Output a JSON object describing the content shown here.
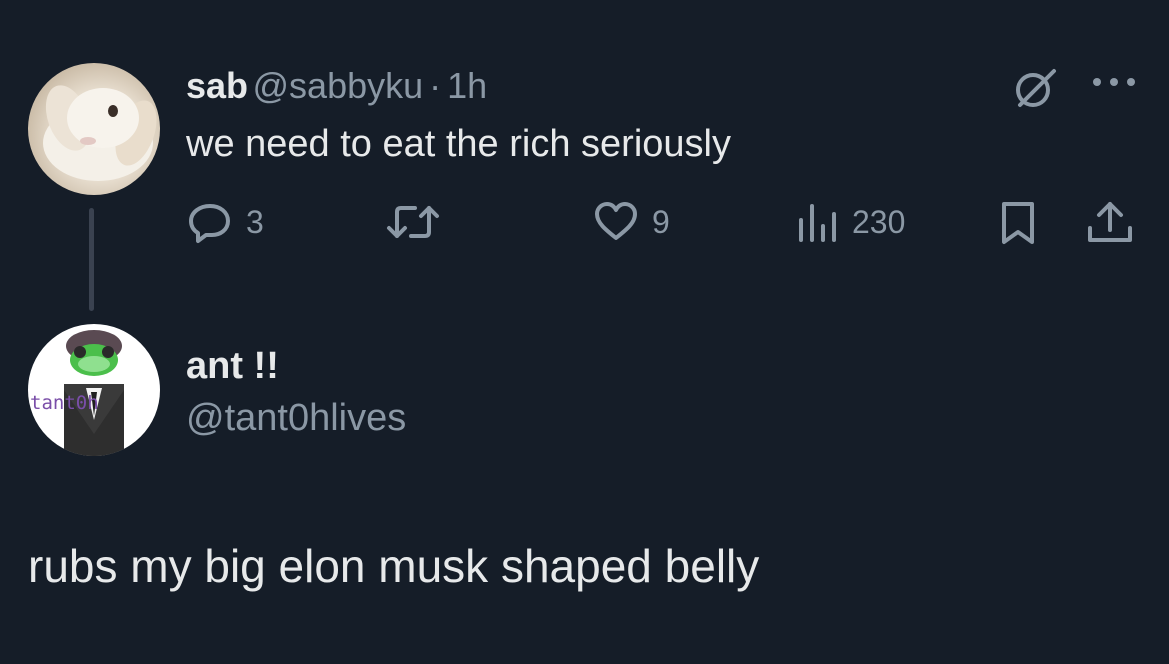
{
  "tweet": {
    "author_name": "sab",
    "author_handle": "@sabbyku",
    "separator": "·",
    "time": "1h",
    "text": "we need to eat the rich seriously",
    "replies": "3",
    "likes": "9",
    "views": "230"
  },
  "reply": {
    "author_name": "ant !!",
    "author_handle": "@tant0hlives",
    "avatar_caption": "tant0h",
    "text": "rubs my big elon musk shaped belly"
  },
  "colors": {
    "background": "#151d28",
    "text": "#e7e9ea",
    "muted": "#8b98a5",
    "thread_line": "#3a4250"
  },
  "icons": [
    "grok-icon",
    "more-icon",
    "reply-icon",
    "retweet-icon",
    "like-icon",
    "views-icon",
    "bookmark-icon",
    "share-icon"
  ]
}
